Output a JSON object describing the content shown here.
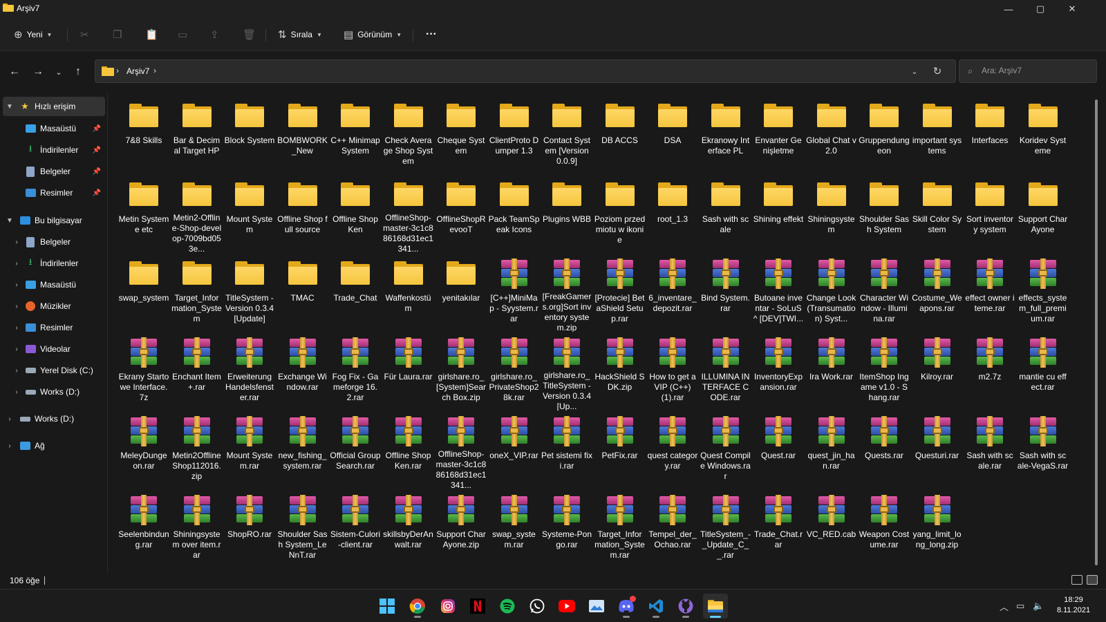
{
  "window": {
    "title": "Arşiv7",
    "minimize": "—",
    "maximize": "▢",
    "close": "✕"
  },
  "toolbar": {
    "new_label": "Yeni",
    "sort_label": "Sırala",
    "view_label": "Görünüm",
    "more_label": "···"
  },
  "address": {
    "crumb": "Arşiv7",
    "sep1": "›",
    "sep2": "›"
  },
  "search": {
    "placeholder": "Ara: Arşiv7"
  },
  "sidebar": {
    "quick_access": "Hızlı erişim",
    "qa_items": [
      "Masaüstü",
      "İndirilenler",
      "Belgeler",
      "Resimler"
    ],
    "this_pc": "Bu bilgisayar",
    "pc_items": [
      "Belgeler",
      "İndirilenler",
      "Masaüstü",
      "Müzikler",
      "Resimler",
      "Videolar",
      "Yerel Disk (C:)",
      "Works (D:)"
    ],
    "drive": "Works (D:)",
    "network": "Ağ"
  },
  "files": [
    {
      "name": "7&8 Skills",
      "type": "folder"
    },
    {
      "name": "Bar & Decimal Target HP",
      "type": "folder"
    },
    {
      "name": "Block System",
      "type": "folder"
    },
    {
      "name": "BOMBWORK_New",
      "type": "folder"
    },
    {
      "name": "C++ Minimap System",
      "type": "folder"
    },
    {
      "name": "Check Average Shop System",
      "type": "folder"
    },
    {
      "name": "Cheque System",
      "type": "folder"
    },
    {
      "name": "ClientProto Dumper 1.3",
      "type": "folder"
    },
    {
      "name": "Contact System [Version 0.0.9]",
      "type": "folder"
    },
    {
      "name": "DB ACCS",
      "type": "folder"
    },
    {
      "name": "DSA",
      "type": "folder"
    },
    {
      "name": "Ekranowy Interface PL",
      "type": "folder"
    },
    {
      "name": "Envanter Genişletme",
      "type": "folder"
    },
    {
      "name": "Global Chat v2.0",
      "type": "folder"
    },
    {
      "name": "Gruppendungeon",
      "type": "folder"
    },
    {
      "name": "important systems",
      "type": "folder"
    },
    {
      "name": "Interfaces",
      "type": "folder"
    },
    {
      "name": "Koridev Systeme",
      "type": "folder"
    },
    {
      "name": "Metin Systeme etc",
      "type": "folder"
    },
    {
      "name": "Metin2-Offline-Shop-develop-7009bd053e...",
      "type": "folder"
    },
    {
      "name": "Mount System",
      "type": "folder"
    },
    {
      "name": "Offline Shop full source",
      "type": "folder"
    },
    {
      "name": "Offline Shop Ken",
      "type": "folder"
    },
    {
      "name": "OfflineShop-master-3c1c886168d31ec1341...",
      "type": "folder"
    },
    {
      "name": "OfflineShopRevooT",
      "type": "folder"
    },
    {
      "name": "Pack TeamSpeak Icons",
      "type": "folder"
    },
    {
      "name": "Plugins WBB",
      "type": "folder"
    },
    {
      "name": "Poziom przedmiotu w ikonie",
      "type": "folder"
    },
    {
      "name": "root_1.3",
      "type": "folder"
    },
    {
      "name": "Sash with scale",
      "type": "folder"
    },
    {
      "name": "Shining effekt",
      "type": "folder"
    },
    {
      "name": "Shiningsystem",
      "type": "folder"
    },
    {
      "name": "Shoulder Sash System",
      "type": "folder"
    },
    {
      "name": "Skill Color System",
      "type": "folder"
    },
    {
      "name": "Sort inventory system",
      "type": "folder"
    },
    {
      "name": "Support Char Ayone",
      "type": "folder"
    },
    {
      "name": "swap_system",
      "type": "folder"
    },
    {
      "name": "Target_Information_System",
      "type": "folder"
    },
    {
      "name": "TitleSystem - Version 0.3.4 [Update]",
      "type": "folder"
    },
    {
      "name": "TMAC",
      "type": "folder"
    },
    {
      "name": "Trade_Chat",
      "type": "folder"
    },
    {
      "name": "Waffenkostüm",
      "type": "folder"
    },
    {
      "name": "yenitakılar",
      "type": "folder"
    },
    {
      "name": "[C++]MiniMap - Syystem.rar",
      "type": "archive"
    },
    {
      "name": "[FreakGamers.org]Sort inventory system.zip",
      "type": "archive"
    },
    {
      "name": "[Protecie] BetaShield Setup.rar",
      "type": "archive"
    },
    {
      "name": "6_inventare_depozit.rar",
      "type": "archive"
    },
    {
      "name": "Bind System.rar",
      "type": "archive"
    },
    {
      "name": "Butoane inventar - SoLuS ^ [DEV]TWI...",
      "type": "archive"
    },
    {
      "name": "Change Look (Transumation) Syst...",
      "type": "archive"
    },
    {
      "name": "Character Window - Illumina.rar",
      "type": "archive"
    },
    {
      "name": "Costume_Weapons.rar",
      "type": "archive"
    },
    {
      "name": "effect owner iteme.rar",
      "type": "archive"
    },
    {
      "name": "effects_system_full_premium.rar",
      "type": "archive"
    },
    {
      "name": "Ekrany Startowe Interface.7z",
      "type": "archive"
    },
    {
      "name": "Enchant Item+.rar",
      "type": "archive"
    },
    {
      "name": "Erweiterung Handelsfenster.rar",
      "type": "archive"
    },
    {
      "name": "Exchange Window.rar",
      "type": "archive"
    },
    {
      "name": "Fog Fix - Gameforge 16.2.rar",
      "type": "archive"
    },
    {
      "name": "Für Laura.rar",
      "type": "archive"
    },
    {
      "name": "girlshare.ro_[System]Search Box.zip",
      "type": "archive"
    },
    {
      "name": "girlshare.ro_PrivateShop28k.rar",
      "type": "archive"
    },
    {
      "name": "girlshare.ro_TitleSystem - Version 0.3.4 [Up...",
      "type": "archive"
    },
    {
      "name": "HackShield SDK.zip",
      "type": "archive"
    },
    {
      "name": "How to get a VIP (C++) (1).rar",
      "type": "archive"
    },
    {
      "name": "ILLUMINA INTERFACE CODE.rar",
      "type": "archive"
    },
    {
      "name": "InventoryExpansion.rar",
      "type": "archive"
    },
    {
      "name": "Ira Work.rar",
      "type": "archive"
    },
    {
      "name": "ItemShop Ingame v1.0 - Shang.rar",
      "type": "archive"
    },
    {
      "name": "Kilroy.rar",
      "type": "archive"
    },
    {
      "name": "m2.7z",
      "type": "archive"
    },
    {
      "name": "mantie cu effect.rar",
      "type": "archive"
    },
    {
      "name": "MeleyDungeon.rar",
      "type": "archive"
    },
    {
      "name": "Metin2OfflineShop112016.zip",
      "type": "archive"
    },
    {
      "name": "Mount System.rar",
      "type": "archive"
    },
    {
      "name": "new_fishing_system.rar",
      "type": "archive"
    },
    {
      "name": "Official Group Search.rar",
      "type": "archive"
    },
    {
      "name": "Offline Shop Ken.rar",
      "type": "archive"
    },
    {
      "name": "OfflineShop-master-3c1c886168d31ec1341...",
      "type": "archive"
    },
    {
      "name": "oneX_VIP.rar",
      "type": "archive"
    },
    {
      "name": "Pet sistemi fixi.rar",
      "type": "archive"
    },
    {
      "name": "PetFix.rar",
      "type": "archive"
    },
    {
      "name": "quest category.rar",
      "type": "archive"
    },
    {
      "name": "Quest Compile Windows.rar",
      "type": "archive"
    },
    {
      "name": "Quest.rar",
      "type": "archive"
    },
    {
      "name": "quest_jin_han.rar",
      "type": "archive"
    },
    {
      "name": "Quests.rar",
      "type": "archive"
    },
    {
      "name": "Questuri.rar",
      "type": "archive"
    },
    {
      "name": "Sash with scale.rar",
      "type": "archive"
    },
    {
      "name": "Sash with scale-VegaS.rar",
      "type": "archive"
    },
    {
      "name": "Seelenbindung.rar",
      "type": "archive"
    },
    {
      "name": "Shiningsystem over item.rar",
      "type": "archive"
    },
    {
      "name": "ShopRO.rar",
      "type": "archive"
    },
    {
      "name": "Shoulder Sash System_LeNnT.rar",
      "type": "archive"
    },
    {
      "name": "Sistem-Culori-client.rar",
      "type": "archive"
    },
    {
      "name": "skillsbyDerAnwalt.rar",
      "type": "archive"
    },
    {
      "name": "Support Char Ayone.zip",
      "type": "archive"
    },
    {
      "name": "swap_system.rar",
      "type": "archive"
    },
    {
      "name": "Systeme-Pongo.rar",
      "type": "archive"
    },
    {
      "name": "Target_Information_System.rar",
      "type": "archive"
    },
    {
      "name": "Tempel_der_Ochao.rar",
      "type": "archive"
    },
    {
      "name": "TitleSystem_-_Update_C__.rar",
      "type": "archive"
    },
    {
      "name": "Trade_Chat.rar",
      "type": "archive"
    },
    {
      "name": "VC_RED.cab",
      "type": "archive"
    },
    {
      "name": "Weapon Costume.rar",
      "type": "archive"
    },
    {
      "name": "yang_limit_long_long.zip",
      "type": "archive"
    }
  ],
  "status": {
    "count": "106 öğe"
  },
  "clock": {
    "time": "18:29",
    "date": "8.11.2021"
  },
  "taskbar_apps": [
    "start",
    "chrome",
    "instagram",
    "netflix",
    "spotify",
    "whatsapp",
    "youtube",
    "photos",
    "discord",
    "vscode",
    "github",
    "file-explorer"
  ],
  "colors": {
    "folder": "#f5c53d",
    "accent": "#60cdff",
    "background": "#191919"
  }
}
